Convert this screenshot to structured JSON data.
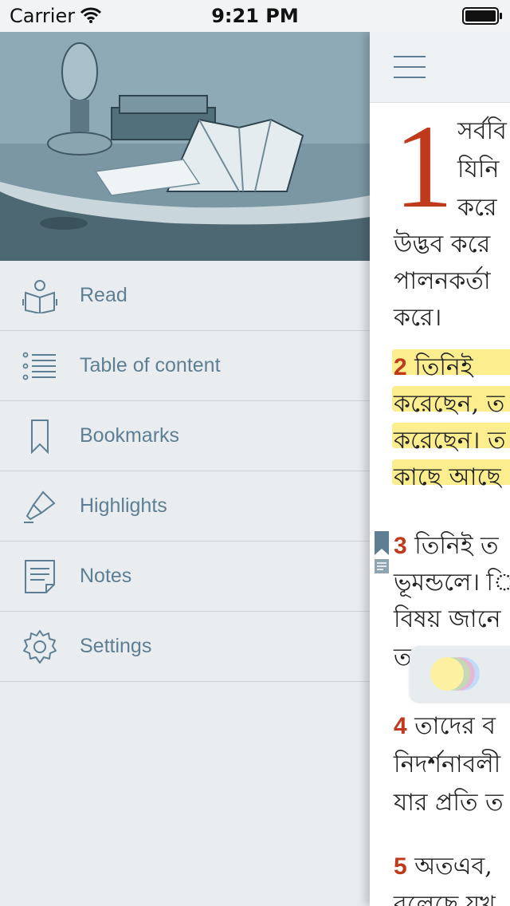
{
  "status_bar": {
    "carrier": "Carrier",
    "time": "9:21 PM"
  },
  "menu": {
    "items": [
      {
        "label": "Read",
        "icon": "book-reader-icon"
      },
      {
        "label": "Table of content",
        "icon": "list-icon"
      },
      {
        "label": "Bookmarks",
        "icon": "bookmark-icon"
      },
      {
        "label": "Highlights",
        "icon": "highlighter-icon"
      },
      {
        "label": "Notes",
        "icon": "note-icon"
      },
      {
        "label": "Settings",
        "icon": "gear-icon"
      }
    ]
  },
  "reader": {
    "chapter_number": "1",
    "lines": [
      "সর্ববি",
      "যিনি",
      "করে",
      "উদ্ভব করে",
      "পালনকর্তা",
      "করে।",
      "তিনিই",
      "করেছেন, ত",
      "করেছেন। ত",
      "কাছে আছে",
      "তিনিই ত",
      "ভূমন্ডলে। ি",
      "বিষয় জানে",
      "ত",
      "তাদের ব",
      "নিদর্শনাবলী",
      "যার প্রতি ত",
      "অতএব,",
      "বলেছে যখ"
    ],
    "verse_numbers": [
      "2",
      "3",
      "4",
      "5"
    ]
  },
  "colors": {
    "accent": "#5e7f93",
    "verse_number": "#c0391b",
    "highlight": "#fbeb7a"
  }
}
